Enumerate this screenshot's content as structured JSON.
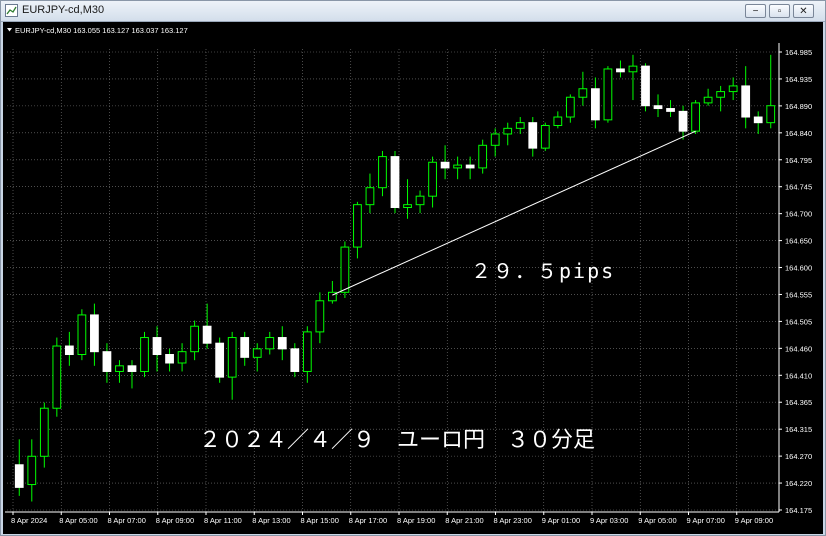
{
  "window": {
    "title": "EURJPY-cd,M30",
    "buttons": {
      "minimize": "−",
      "restore": "▫",
      "close": "✕"
    }
  },
  "chart_data": {
    "type": "candlestick",
    "header": "EURJPY-cd,M30  163.055 163.127 163.037 163.127",
    "price_ticks": [
      "164.985",
      "164.935",
      "164.890",
      "164.840",
      "164.795",
      "164.745",
      "164.700",
      "164.650",
      "164.600",
      "164.555",
      "164.505",
      "164.460",
      "164.410",
      "164.365",
      "164.315",
      "164.270",
      "164.220",
      "164.175"
    ],
    "time_labels": [
      "8 Apr 2024",
      "8 Apr 05:00",
      "8 Apr 07:00",
      "8 Apr 09:00",
      "8 Apr 11:00",
      "8 Apr 13:00",
      "8 Apr 15:00",
      "8 Apr 17:00",
      "8 Apr 19:00",
      "8 Apr 21:00",
      "8 Apr 23:00",
      "9 Apr 01:00",
      "9 Apr 03:00",
      "9 Apr 05:00",
      "9 Apr 07:00",
      "9 Apr 09:00"
    ],
    "ylim": [
      164.175,
      164.985
    ],
    "bull_color": "#ffffff",
    "bear_color": "#ffffff",
    "wick_color": "#00ff00",
    "grid": true,
    "candles": [
      [
        164.255,
        164.3,
        164.2,
        164.215
      ],
      [
        164.22,
        164.3,
        164.19,
        164.27
      ],
      [
        164.27,
        164.365,
        164.25,
        164.355
      ],
      [
        164.355,
        164.48,
        164.34,
        164.465
      ],
      [
        164.465,
        164.49,
        164.43,
        164.45
      ],
      [
        164.45,
        164.53,
        164.44,
        164.52
      ],
      [
        164.52,
        164.54,
        164.43,
        164.455
      ],
      [
        164.455,
        164.47,
        164.4,
        164.42
      ],
      [
        164.42,
        164.44,
        164.4,
        164.43
      ],
      [
        164.43,
        164.44,
        164.39,
        164.42
      ],
      [
        164.42,
        164.49,
        164.41,
        164.48
      ],
      [
        164.48,
        164.5,
        164.42,
        164.45
      ],
      [
        164.45,
        164.46,
        164.42,
        164.435
      ],
      [
        164.435,
        164.47,
        164.42,
        164.455
      ],
      [
        164.455,
        164.51,
        164.44,
        164.5
      ],
      [
        164.5,
        164.54,
        164.46,
        164.47
      ],
      [
        164.47,
        164.48,
        164.4,
        164.41
      ],
      [
        164.41,
        164.49,
        164.37,
        164.48
      ],
      [
        164.48,
        164.49,
        164.43,
        164.445
      ],
      [
        164.445,
        164.47,
        164.42,
        164.46
      ],
      [
        164.46,
        164.49,
        164.45,
        164.48
      ],
      [
        164.48,
        164.5,
        164.44,
        164.46
      ],
      [
        164.46,
        164.47,
        164.41,
        164.42
      ],
      [
        164.42,
        164.5,
        164.4,
        164.49
      ],
      [
        164.49,
        164.56,
        164.47,
        164.545
      ],
      [
        164.545,
        164.58,
        164.54,
        164.56
      ],
      [
        164.56,
        164.65,
        164.55,
        164.64
      ],
      [
        164.64,
        164.72,
        164.62,
        164.715
      ],
      [
        164.715,
        164.77,
        164.7,
        164.745
      ],
      [
        164.745,
        164.81,
        164.73,
        164.8
      ],
      [
        164.8,
        164.81,
        164.7,
        164.71
      ],
      [
        164.71,
        164.76,
        164.69,
        164.715
      ],
      [
        164.715,
        164.74,
        164.7,
        164.73
      ],
      [
        164.73,
        164.8,
        164.71,
        164.79
      ],
      [
        164.79,
        164.82,
        164.76,
        164.78
      ],
      [
        164.78,
        164.8,
        164.76,
        164.785
      ],
      [
        164.785,
        164.8,
        164.76,
        164.78
      ],
      [
        164.78,
        164.83,
        164.77,
        164.82
      ],
      [
        164.82,
        164.85,
        164.8,
        164.84
      ],
      [
        164.84,
        164.86,
        164.82,
        164.85
      ],
      [
        164.85,
        164.87,
        164.84,
        164.86
      ],
      [
        164.86,
        164.87,
        164.8,
        164.815
      ],
      [
        164.815,
        164.86,
        164.81,
        164.855
      ],
      [
        164.855,
        164.88,
        164.85,
        164.87
      ],
      [
        164.87,
        164.91,
        164.86,
        164.905
      ],
      [
        164.905,
        164.95,
        164.89,
        164.92
      ],
      [
        164.92,
        164.94,
        164.85,
        164.865
      ],
      [
        164.865,
        164.96,
        164.86,
        164.955
      ],
      [
        164.955,
        164.97,
        164.94,
        164.95
      ],
      [
        164.95,
        164.98,
        164.9,
        164.96
      ],
      [
        164.96,
        164.965,
        164.88,
        164.89
      ],
      [
        164.89,
        164.91,
        164.87,
        164.885
      ],
      [
        164.885,
        164.9,
        164.87,
        164.88
      ],
      [
        164.88,
        164.89,
        164.83,
        164.845
      ],
      [
        164.845,
        164.9,
        164.84,
        164.895
      ],
      [
        164.895,
        164.92,
        164.89,
        164.905
      ],
      [
        164.905,
        164.925,
        164.88,
        164.915
      ],
      [
        164.915,
        164.94,
        164.9,
        164.925
      ],
      [
        164.925,
        164.96,
        164.85,
        164.87
      ],
      [
        164.87,
        164.88,
        164.84,
        164.86
      ],
      [
        164.86,
        164.98,
        164.85,
        164.89
      ]
    ],
    "trendline": {
      "from": [
        25,
        164.555
      ],
      "to": [
        54,
        164.845
      ]
    },
    "annotations": {
      "pips": "２９．５pips",
      "date": "２０２４／４／９　ユーロ円　３０分足"
    }
  }
}
